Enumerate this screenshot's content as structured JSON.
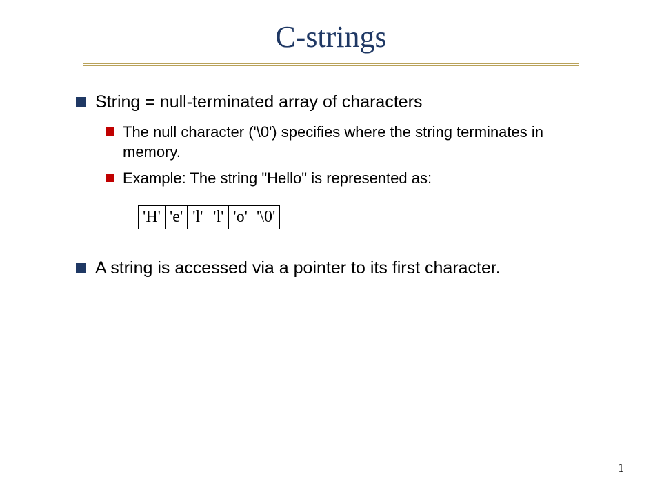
{
  "title": "C-strings",
  "bullets": {
    "b1": "String = null-terminated array of characters",
    "b1a": "The null character ('\\0') specifies where the string terminates in memory.",
    "b1b": "Example: The string \"Hello\" is represented as:",
    "b2": "A string is accessed via a pointer to its first character."
  },
  "cells": {
    "c0": "'H'",
    "c1": "'e'",
    "c2": "'l'",
    "c3": "'l'",
    "c4": "'o'",
    "c5": "'\\0'"
  },
  "page_number": "1"
}
